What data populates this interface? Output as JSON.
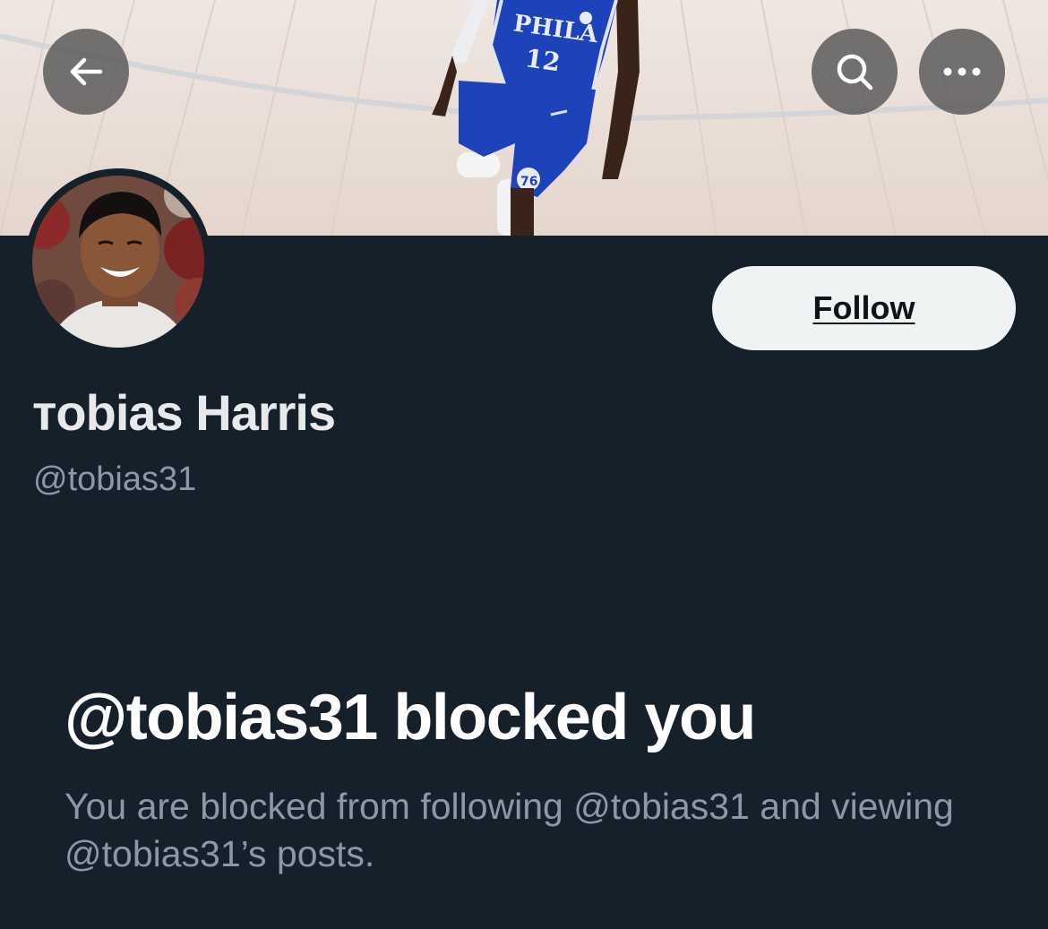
{
  "header": {
    "back_icon": "arrow-left-icon",
    "search_icon": "search-icon",
    "more_icon": "more-horizontal-icon"
  },
  "banner": {
    "jersey_text": "PHILA",
    "jersey_number": "12",
    "shorts_logo": "76"
  },
  "profile": {
    "display_name": "ᴛobias Harris",
    "handle": "@tobias31",
    "follow_label": "Follow"
  },
  "blocked": {
    "title": "@tobias31 blocked you",
    "description": "You are blocked from following @tobias31 and viewing @tobias31’s posts."
  },
  "colors": {
    "background": "#15202b",
    "primary_text": "#e7e9ea",
    "secondary_text": "#8b98a5",
    "follow_bg": "#eff3f4",
    "overlay_button": "#505050",
    "jersey_blue": "#1d42ba"
  }
}
